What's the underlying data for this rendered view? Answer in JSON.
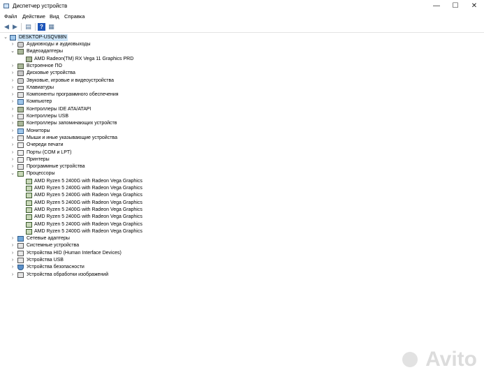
{
  "window": {
    "title": "Диспетчер устройств",
    "minimize": "—",
    "maximize": "☐",
    "close": "✕"
  },
  "menu": [
    "Файл",
    "Действие",
    "Вид",
    "Справка"
  ],
  "toolbar": {
    "back": "◀",
    "forward": "▶",
    "properties": "▤",
    "help": "?",
    "view": "▦"
  },
  "tree": {
    "root": "DESKTOP-USQV88N",
    "items": [
      {
        "label": "Аудиовходы и аудиовыходы",
        "icon": "speaker-icon",
        "expanded": false
      },
      {
        "label": "Видеоадаптеры",
        "icon": "display-adapter-icon",
        "expanded": true
      },
      {
        "label": "AMD Radeon(TM) RX Vega 11 Graphics PRD",
        "icon": "display-adapter-icon",
        "child": true
      },
      {
        "label": "Встроенное ПО",
        "icon": "firmware-icon",
        "expanded": false
      },
      {
        "label": "Дисковые устройства",
        "icon": "disk-icon",
        "expanded": false
      },
      {
        "label": "Звуковые, игровые и видеоустройства",
        "icon": "speaker-icon",
        "expanded": false
      },
      {
        "label": "Клавиатуры",
        "icon": "keyboard-icon",
        "expanded": false
      },
      {
        "label": "Компоненты программного обеспечения",
        "icon": "software-component-icon",
        "expanded": false
      },
      {
        "label": "Компьютер",
        "icon": "computer-icon",
        "expanded": false
      },
      {
        "label": "Контроллеры IDE ATA/ATAPI",
        "icon": "ide-controller-icon",
        "expanded": false
      },
      {
        "label": "Контроллеры USB",
        "icon": "usb-icon",
        "expanded": false
      },
      {
        "label": "Контроллеры запоминающих устройств",
        "icon": "storage-controller-icon",
        "expanded": false
      },
      {
        "label": "Мониторы",
        "icon": "monitor-icon",
        "expanded": false
      },
      {
        "label": "Мыши и иные указывающие устройства",
        "icon": "mouse-icon",
        "expanded": false
      },
      {
        "label": "Очереди печати",
        "icon": "print-queue-icon",
        "expanded": false
      },
      {
        "label": "Порты (COM и LPT)",
        "icon": "port-icon",
        "expanded": false
      },
      {
        "label": "Принтеры",
        "icon": "printer-icon",
        "expanded": false
      },
      {
        "label": "Программные устройства",
        "icon": "software-device-icon",
        "expanded": false
      },
      {
        "label": "Процессоры",
        "icon": "cpu-icon",
        "expanded": true
      },
      {
        "label": "AMD Ryzen 5 2400G with Radeon Vega Graphics",
        "icon": "cpu-icon",
        "child": true
      },
      {
        "label": "AMD Ryzen 5 2400G with Radeon Vega Graphics",
        "icon": "cpu-icon",
        "child": true
      },
      {
        "label": "AMD Ryzen 5 2400G with Radeon Vega Graphics",
        "icon": "cpu-icon",
        "child": true
      },
      {
        "label": "AMD Ryzen 5 2400G with Radeon Vega Graphics",
        "icon": "cpu-icon",
        "child": true
      },
      {
        "label": "AMD Ryzen 5 2400G with Radeon Vega Graphics",
        "icon": "cpu-icon",
        "child": true
      },
      {
        "label": "AMD Ryzen 5 2400G with Radeon Vega Graphics",
        "icon": "cpu-icon",
        "child": true
      },
      {
        "label": "AMD Ryzen 5 2400G with Radeon Vega Graphics",
        "icon": "cpu-icon",
        "child": true
      },
      {
        "label": "AMD Ryzen 5 2400G with Radeon Vega Graphics",
        "icon": "cpu-icon",
        "child": true
      },
      {
        "label": "Сетевые адаптеры",
        "icon": "network-adapter-icon",
        "expanded": false
      },
      {
        "label": "Системные устройства",
        "icon": "system-device-icon",
        "expanded": false
      },
      {
        "label": "Устройства HID (Human Interface Devices)",
        "icon": "hid-icon",
        "expanded": false
      },
      {
        "label": "Устройства USB",
        "icon": "usb-icon",
        "expanded": false
      },
      {
        "label": "Устройства безопасности",
        "icon": "security-icon",
        "expanded": false
      },
      {
        "label": "Устройства обработки изображений",
        "icon": "imaging-icon",
        "expanded": false
      }
    ]
  },
  "watermark": "Avito"
}
